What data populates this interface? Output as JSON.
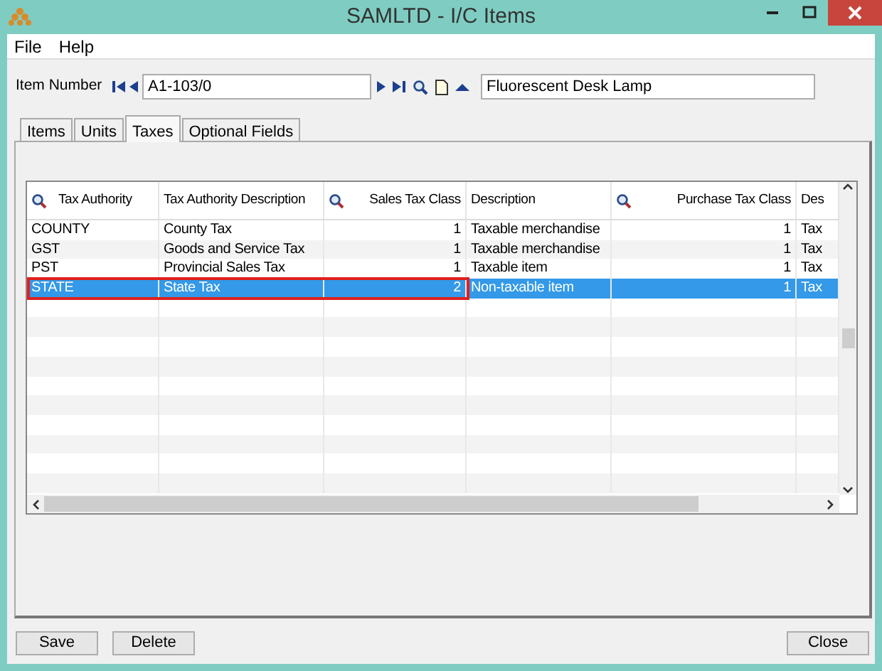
{
  "window": {
    "title": "SAMLTD - I/C Items"
  },
  "menu": [
    "File",
    "Help"
  ],
  "item_number": {
    "label": "Item Number",
    "value": "A1-103/0",
    "description": "Fluorescent Desk Lamp"
  },
  "tabs": [
    {
      "label": "Items",
      "selected": false
    },
    {
      "label": "Units",
      "selected": false
    },
    {
      "label": "Taxes",
      "selected": true
    },
    {
      "label": "Optional Fields",
      "selected": false
    }
  ],
  "table": {
    "columns": [
      {
        "label": "Tax Authority",
        "searchable": true,
        "kind": "text"
      },
      {
        "label": "Tax Authority Description",
        "searchable": false,
        "kind": "text"
      },
      {
        "label": "Sales Tax Class",
        "searchable": true,
        "kind": "number"
      },
      {
        "label": "Description",
        "searchable": false,
        "kind": "text"
      },
      {
        "label": "Purchase Tax Class",
        "searchable": true,
        "kind": "number"
      },
      {
        "label": "Des",
        "searchable": false,
        "kind": "text"
      }
    ],
    "rows": [
      {
        "cells": [
          "COUNTY",
          "County Tax",
          "1",
          "Taxable merchandise",
          "1",
          "Tax"
        ],
        "selected": false,
        "outlined": false
      },
      {
        "cells": [
          "GST",
          "Goods and Service Tax",
          "1",
          "Taxable merchandise",
          "1",
          "Tax"
        ],
        "selected": false,
        "outlined": false
      },
      {
        "cells": [
          "PST",
          "Provincial Sales Tax",
          "1",
          "Taxable item",
          "1",
          "Tax"
        ],
        "selected": false,
        "outlined": false
      },
      {
        "cells": [
          "STATE",
          "State Tax",
          "2",
          "Non-taxable item",
          "1",
          "Tax"
        ],
        "selected": true,
        "outlined": true
      }
    ]
  },
  "buttons": [
    "Save",
    "Delete"
  ],
  "close_button": "Close"
}
